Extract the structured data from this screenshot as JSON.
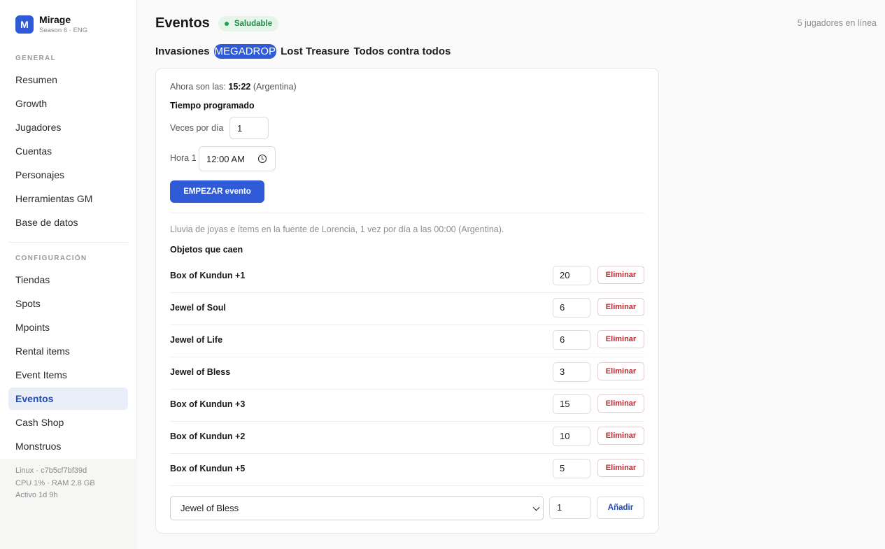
{
  "brand": {
    "logo_letter": "M",
    "name": "Mirage",
    "subtitle": "Season 6 · ENG"
  },
  "sidebar": {
    "general_label": "GENERAL",
    "general_items": [
      {
        "label": "Resumen"
      },
      {
        "label": "Growth"
      },
      {
        "label": "Jugadores"
      },
      {
        "label": "Cuentas"
      },
      {
        "label": "Personajes"
      },
      {
        "label": "Herramientas GM"
      },
      {
        "label": "Base de datos"
      }
    ],
    "config_label": "CONFIGURACIÓN",
    "config_items": [
      {
        "label": "Tiendas"
      },
      {
        "label": "Spots"
      },
      {
        "label": "Mpoints"
      },
      {
        "label": "Rental items"
      },
      {
        "label": "Event Items"
      },
      {
        "label": "Eventos",
        "active": true
      },
      {
        "label": "Cash Shop"
      },
      {
        "label": "Monstruos"
      }
    ],
    "footer": {
      "line1": "Linux · c7b5cf7bf39d",
      "line2": "CPU 1% · RAM 2.8 GB",
      "line3": "Activo 1d 9h"
    }
  },
  "header": {
    "title": "Eventos",
    "status": "Saludable",
    "online": "5 jugadores en línea"
  },
  "tabs": [
    {
      "label": "Invasiones"
    },
    {
      "label": "MEGADROP",
      "active": true
    },
    {
      "label": "Lost Treasure"
    },
    {
      "label": "Todos contra todos"
    }
  ],
  "schedule": {
    "now_prefix": "Ahora son las:",
    "now_time": "15:22",
    "now_suffix": "(Argentina)",
    "heading": "Tiempo programado",
    "times_label": "Veces por día",
    "times_value": "1",
    "hour_label": "Hora 1",
    "hour_value": "12:00 AM",
    "start_button": "EMPEZAR evento"
  },
  "drops": {
    "description": "Lluvia de joyas e ítems en la fuente de Lorencia, 1 vez por día a las 00:00 (Argentina).",
    "heading": "Objetos que caen",
    "delete_label": "Eliminar",
    "items": [
      {
        "name": "Box of Kundun +1",
        "qty": "20"
      },
      {
        "name": "Jewel of Soul",
        "qty": "6"
      },
      {
        "name": "Jewel of Life",
        "qty": "6"
      },
      {
        "name": "Jewel of Bless",
        "qty": "3"
      },
      {
        "name": "Box of Kundun +3",
        "qty": "15"
      },
      {
        "name": "Box of Kundun +2",
        "qty": "10"
      },
      {
        "name": "Box of Kundun +5",
        "qty": "5"
      }
    ],
    "add": {
      "selected": "Jewel of Bless",
      "qty": "1",
      "button": "Añadir"
    }
  },
  "colors": {
    "accent": "#2f5bd9",
    "status_green": "#1f8a45",
    "danger": "#b8262e"
  }
}
